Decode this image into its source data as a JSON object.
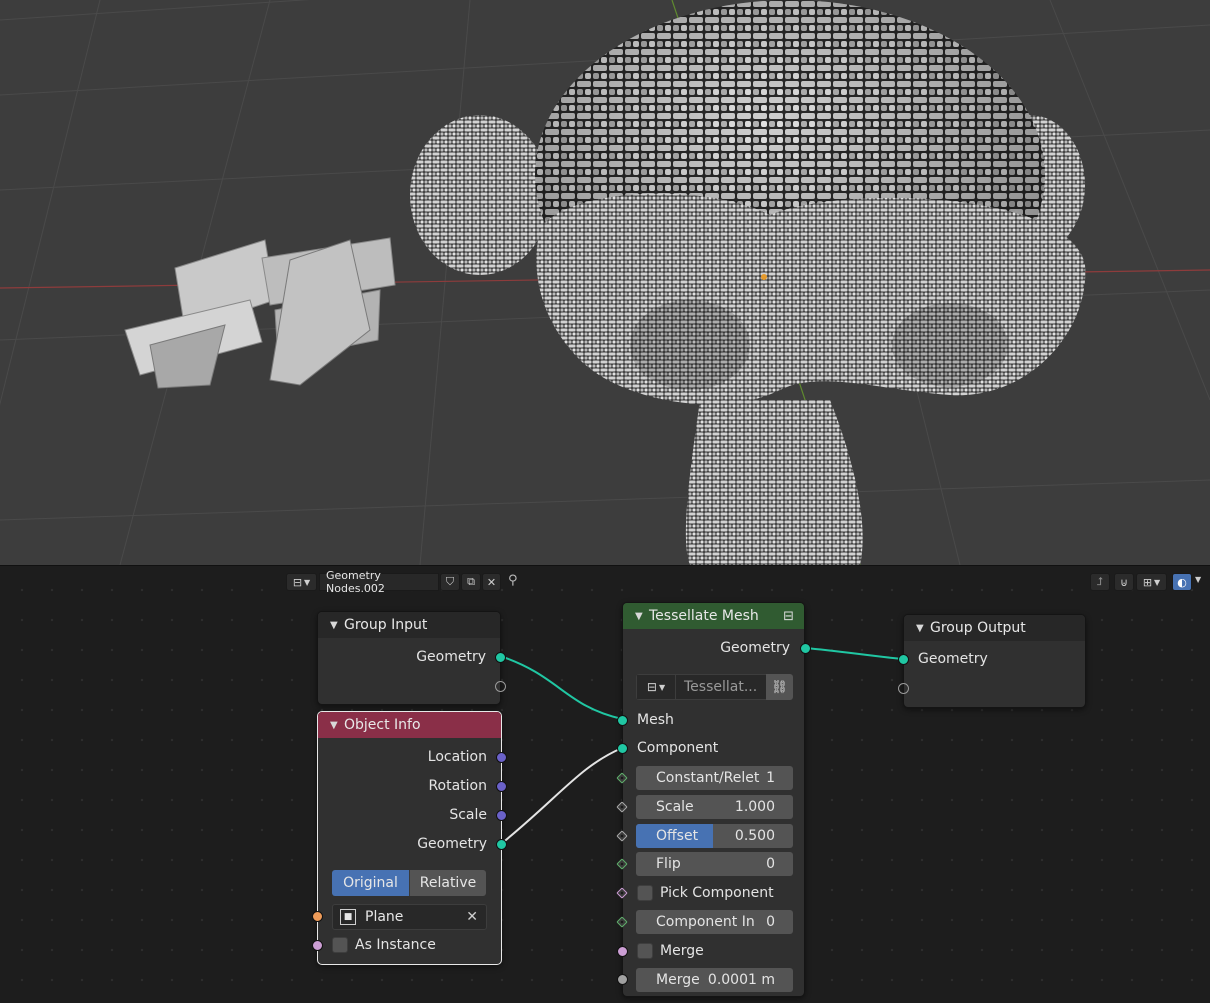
{
  "header": {
    "node_tree_name": "Geometry Nodes.002"
  },
  "nodes": {
    "group_input": {
      "title": "Group Input",
      "outputs": [
        "Geometry"
      ]
    },
    "object_info": {
      "title": "Object Info",
      "outputs": [
        "Location",
        "Rotation",
        "Scale",
        "Geometry"
      ],
      "mode_options": [
        "Original",
        "Relative"
      ],
      "mode_selected": "Original",
      "object_value": "Plane",
      "as_instance_label": "As Instance"
    },
    "tessellate_mesh": {
      "title": "Tessellate Mesh",
      "output": "Geometry",
      "subgroup_name": "Tessellat...",
      "inputs": {
        "mesh": "Mesh",
        "component": "Component",
        "constant_label": "Constant/Relet",
        "constant_value": "1",
        "scale_label": "Scale",
        "scale_value": "1.000",
        "offset_label": "Offset",
        "offset_value": "0.500",
        "flip_label": "Flip",
        "flip_value": "0",
        "pick_component_label": "Pick Component",
        "component_index_label": "Component In",
        "component_index_value": "0",
        "merge_label": "Merge",
        "merge_distance_label": "Merge",
        "merge_distance_value": "0.0001 m"
      }
    },
    "group_output": {
      "title": "Group Output",
      "inputs": [
        "Geometry"
      ]
    }
  },
  "colors": {
    "geometry_socket": "#20c7a3",
    "vector_socket": "#6a61c8",
    "object_socket": "#ee9b59",
    "boolean_socket": "#cc9ed4",
    "geometry_node_header": "#305b31",
    "input_node_header": "#8a2f48",
    "selection_blue": "#4772b3"
  }
}
